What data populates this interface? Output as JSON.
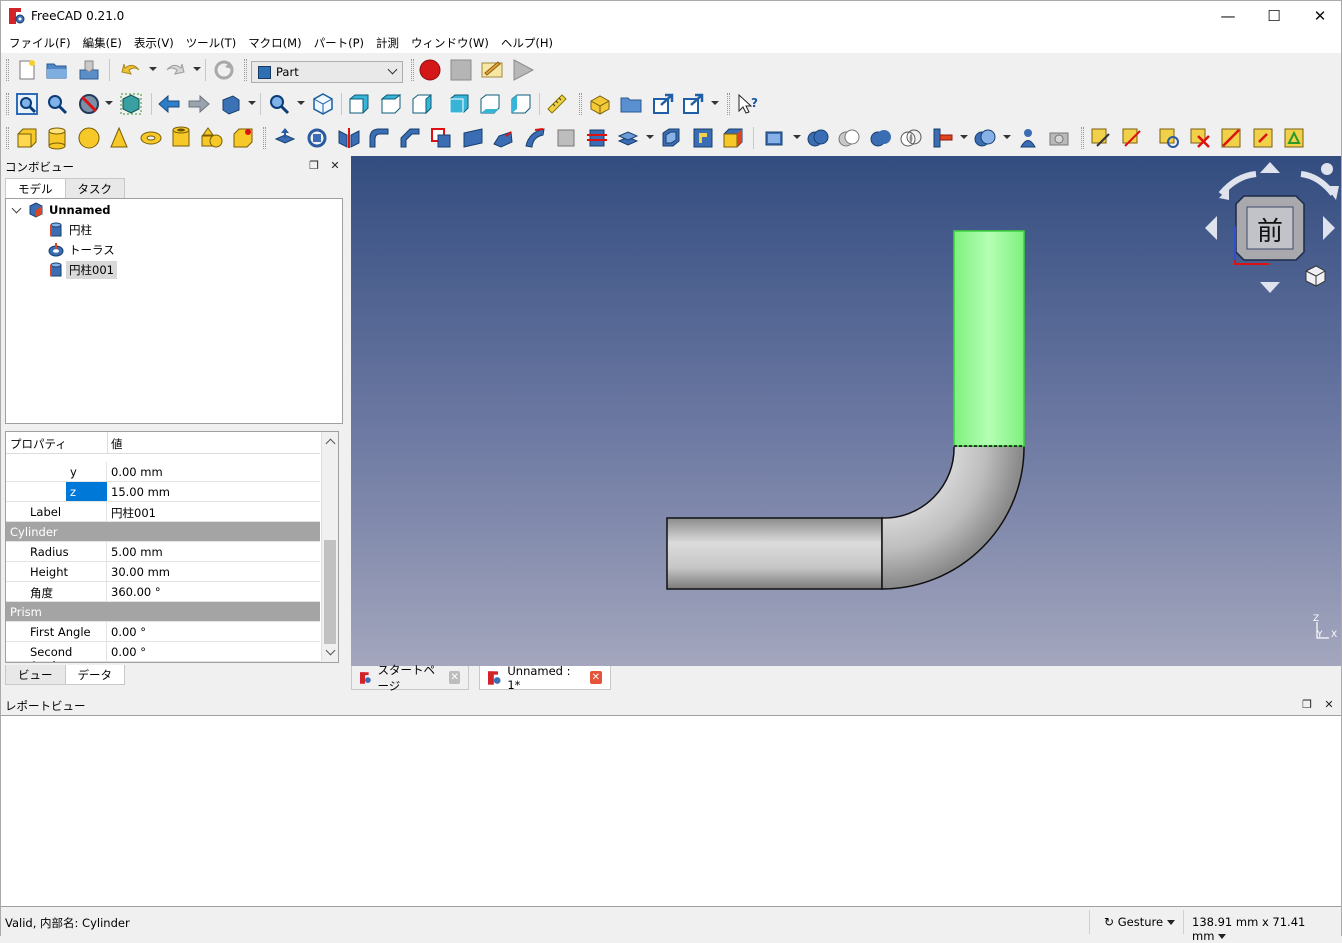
{
  "window": {
    "title": "FreeCAD 0.21.0"
  },
  "menu": [
    "ファイル(F)",
    "編集(E)",
    "表示(V)",
    "ツール(T)",
    "マクロ(M)",
    "パート(P)",
    "計測",
    "ウィンドウ(W)",
    "ヘルプ(H)"
  ],
  "toolbar": {
    "workbench": "Part"
  },
  "combo": {
    "title": "コンボビュー",
    "tabs": [
      "モデル",
      "タスク"
    ],
    "tree": {
      "root": "Unnamed",
      "children": [
        "円柱",
        "トーラス",
        "円柱001"
      ],
      "selected_index": 2
    }
  },
  "properties": {
    "headers": [
      "プロパティ",
      "値"
    ],
    "rows": [
      {
        "name": "y",
        "value": "0.00 mm",
        "indent": true
      },
      {
        "name": "z",
        "value": "15.00 mm",
        "indent": true,
        "selected": true
      },
      {
        "name": "Label",
        "value": "円柱001"
      }
    ],
    "cylinder_group": "Cylinder",
    "cylinder_rows": [
      {
        "name": "Radius",
        "value": "5.00 mm"
      },
      {
        "name": "Height",
        "value": "30.00 mm"
      },
      {
        "name": "角度",
        "value": "360.00 °"
      }
    ],
    "prism_group": "Prism",
    "prism_rows": [
      {
        "name": "First Angle",
        "value": "0.00 °"
      },
      {
        "name": "Second Angle",
        "value": "0.00 °"
      }
    ],
    "bottom_tabs": [
      "ビュー",
      "データ"
    ]
  },
  "viewcube": {
    "face": "前"
  },
  "axis": {
    "z": "Z",
    "y": "Y",
    "x": "X"
  },
  "doc_tabs": [
    {
      "label": "スタートページ",
      "active": false
    },
    {
      "label": "Unnamed : 1*",
      "active": true
    }
  ],
  "report": {
    "title": "レポートビュー"
  },
  "status": {
    "text": "Valid, 内部名: Cylinder",
    "nav_style": "Gesture",
    "dimensions": "138.91 mm x 71.41 mm"
  },
  "colors": {
    "selection_green": "#8ef58e",
    "bg_top": "#334d80",
    "bg_bottom": "#a3a6bd",
    "shape_gray": "#cfcfcf"
  }
}
